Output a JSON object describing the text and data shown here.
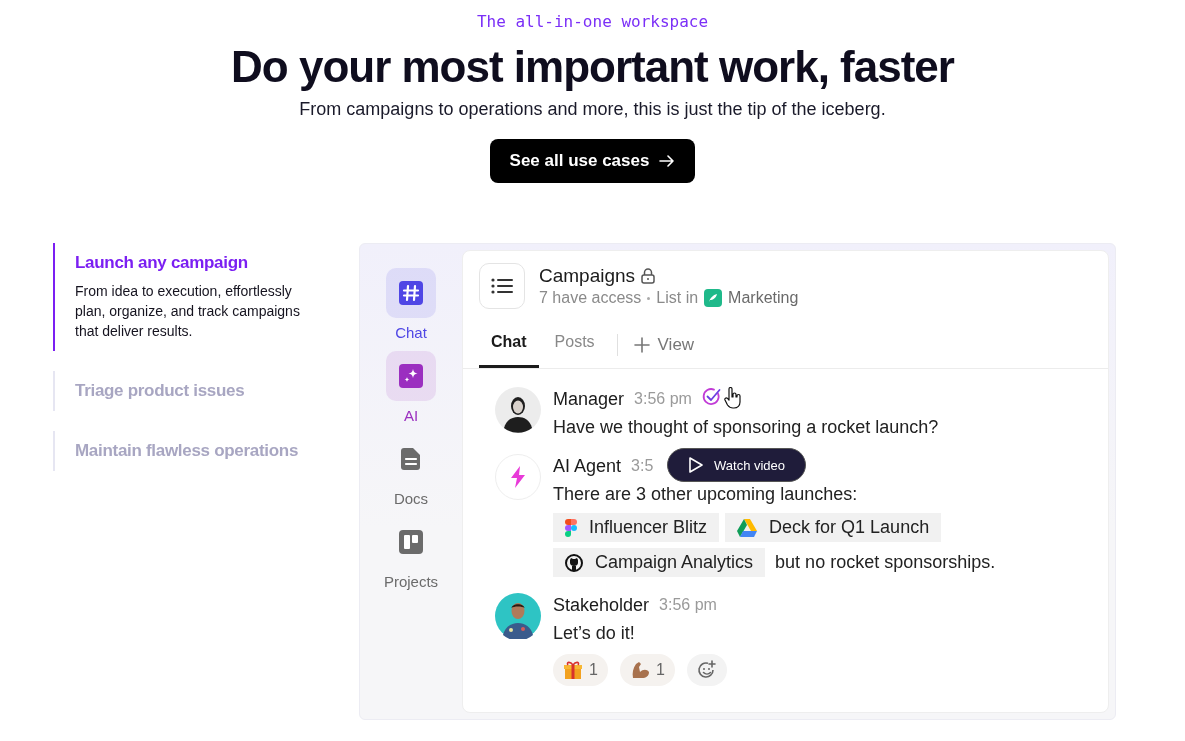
{
  "eyebrow": "The all-in-one workspace",
  "headline": "Do your most important work, faster",
  "subheadline": "From campaigns to operations and more, this is just the tip of the iceberg.",
  "cta": "See all use cases",
  "use_cases": [
    {
      "title": "Launch any campaign",
      "description": "From idea to execution, effortlessly plan, organize, and track campaigns that deliver results.",
      "selected": true
    },
    {
      "title": "Triage product issues",
      "selected": false
    },
    {
      "title": "Maintain flawless operations",
      "selected": false
    }
  ],
  "app": {
    "nav": [
      {
        "kind": "chat",
        "label": "Chat",
        "highlighted": true,
        "color": "#4f46e5"
      },
      {
        "kind": "ai",
        "label": "AI",
        "highlighted": true,
        "color": "#9b2fc0"
      },
      {
        "kind": "docs",
        "label": "Docs",
        "highlighted": false,
        "color": "#6b6b6b"
      },
      {
        "kind": "projects",
        "label": "Projects",
        "highlighted": false,
        "color": "#6b6b6b"
      }
    ],
    "list": {
      "title": "Campaigns",
      "locked": true,
      "access": "7 have access",
      "location_prefix": "List in",
      "space": "Marketing"
    },
    "tabs": [
      {
        "label": "Chat",
        "selected": true
      },
      {
        "label": "Posts",
        "selected": false
      }
    ],
    "add_view": "View",
    "messages": [
      {
        "color": "#ececec",
        "author": "Manager",
        "time": "3:56 pm",
        "verified": true,
        "text": "Have we thought of sponsoring a rocket launch?"
      },
      {
        "kind": "bot",
        "author": "AI Agent",
        "time": "3:5",
        "text": "There are 3 other upcoming launches:",
        "attachments": [
          {
            "kind": "figma",
            "label": "Influencer Blitz"
          },
          {
            "kind": "drive",
            "label": "Deck for Q1 Launch"
          },
          {
            "kind": "github",
            "label": "Campaign Analytics"
          }
        ],
        "after": "but no rocket sponsorships."
      },
      {
        "color": "#2ec4c4",
        "author": "Stakeholder",
        "time": "3:56 pm",
        "text": "Let’s do it!",
        "reactions": [
          {
            "kind": "gift",
            "count": "1"
          },
          {
            "kind": "arm",
            "count": "1"
          }
        ]
      }
    ],
    "watch_video": "Watch video"
  }
}
